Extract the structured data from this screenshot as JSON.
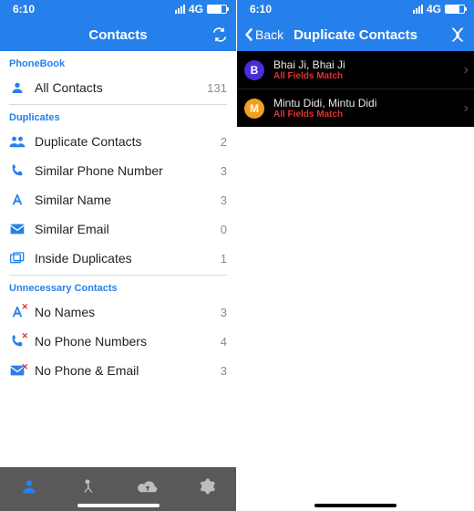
{
  "status": {
    "time": "6:10",
    "net": "4G"
  },
  "left": {
    "title": "Contacts",
    "sections": [
      {
        "header": "PhoneBook",
        "rows": [
          {
            "icon": "person",
            "label": "All Contacts",
            "count": "131"
          }
        ]
      },
      {
        "header": "Duplicates",
        "rows": [
          {
            "icon": "people",
            "label": "Duplicate Contacts",
            "count": "2"
          },
          {
            "icon": "phone",
            "label": "Similar Phone Number",
            "count": "3"
          },
          {
            "icon": "letter",
            "label": "Similar Name",
            "count": "3"
          },
          {
            "icon": "mail",
            "label": "Similar Email",
            "count": "0"
          },
          {
            "icon": "nested",
            "label": "Inside Duplicates",
            "count": "1"
          }
        ]
      },
      {
        "header": "Unnecessary Contacts",
        "rows": [
          {
            "icon": "letter-x",
            "label": "No Names",
            "count": "3"
          },
          {
            "icon": "phone-x",
            "label": "No Phone Numbers",
            "count": "4"
          },
          {
            "icon": "mail-x",
            "label": "No Phone & Email",
            "count": "3"
          }
        ]
      }
    ],
    "tabs": [
      "contacts",
      "merge",
      "cloud",
      "settings"
    ]
  },
  "right": {
    "back": "Back",
    "title": "Duplicate Contacts",
    "items": [
      {
        "initial": "B",
        "color": "#4b2cd6",
        "name": "Bhai Ji, Bhai Ji",
        "sub": "All Fields Match"
      },
      {
        "initial": "M",
        "color": "#f59f1e",
        "name": "Mintu Didi, Mintu Didi",
        "sub": "All Fields Match"
      }
    ]
  }
}
